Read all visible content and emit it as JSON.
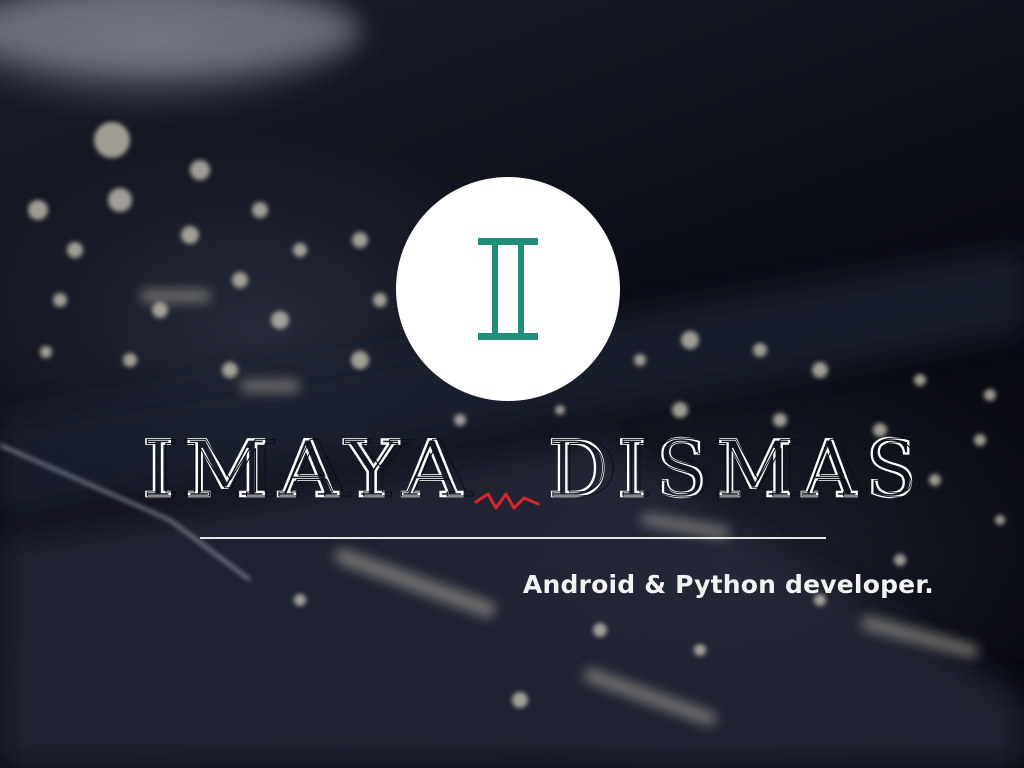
{
  "profile": {
    "monogram": "I",
    "name_first": "IMAYA",
    "name_last": "DISMAS",
    "tagline": "Android & Python developer."
  },
  "colors": {
    "background": "#0a0c14",
    "emblem_circle": "#ffffff",
    "monogram": "#1f8f7a",
    "name_text": "#ffffff",
    "accent_mark": "#d7262b",
    "rule": "#e6e6e6",
    "tagline": "#f2f2f2"
  },
  "icons": {
    "emblem": "monogram-badge",
    "accent": "red-zigzag-mark"
  }
}
